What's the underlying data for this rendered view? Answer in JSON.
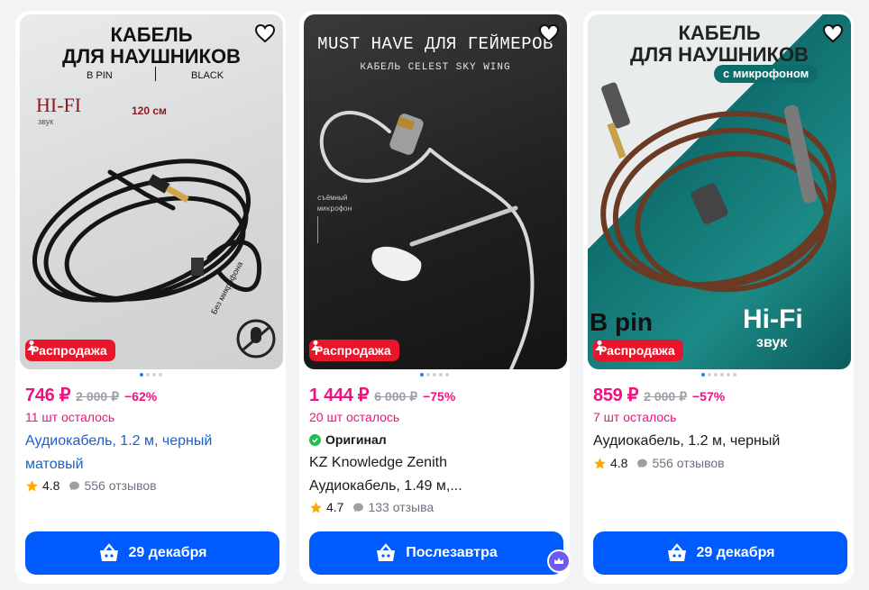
{
  "cards": [
    {
      "photo": {
        "title_line1": "КАБЕЛЬ",
        "title_line2": "ДЛЯ НАУШНИКОВ",
        "sub_left": "B PIN",
        "sub_right": "BLACK",
        "hifi": "HI-FI",
        "sound": "звук",
        "length": "120 см",
        "badge_ring": "Без микрофона"
      },
      "sale_label": "Распродажа",
      "price": "746 ₽",
      "old_price": "2 000 ₽",
      "discount": "−62%",
      "stock": "11 шт осталось",
      "title_lines": [
        "Аудиокабель, 1.2 м, черный",
        "матовый"
      ],
      "rating": "4.8",
      "reviews": "556 отзывов",
      "button": "29 декабря"
    },
    {
      "photo": {
        "title_line1": "MUST HAVE ДЛЯ ГЕЙМЕРОВ",
        "sub": "КАБЕЛЬ CELEST SKY WING",
        "note_line1": "съёмный",
        "note_line2": "микрофон"
      },
      "sale_label": "Распродажа",
      "price": "1 444 ₽",
      "old_price": "6 000 ₽",
      "discount": "−75%",
      "stock": "20 шт осталось",
      "original_label": "Оригинал",
      "brand_line": "KZ Knowledge Zenith",
      "title_line": "Аудиокабель, 1.49 м,...",
      "rating": "4.7",
      "reviews": "133 отзыва",
      "button": "Послезавтра"
    },
    {
      "photo": {
        "title_line1": "КАБЕЛЬ",
        "title_line2": "ДЛЯ НАУШНИКОВ",
        "pill": "с микрофоном",
        "hifi": "Hi-Fi",
        "sound": "звук",
        "bpin": "B pin"
      },
      "sale_label": "Распродажа",
      "price": "859 ₽",
      "old_price": "2 000 ₽",
      "discount": "−57%",
      "stock": "7 шт осталось",
      "title_line": "Аудиокабель, 1.2 м, черный",
      "rating": "4.8",
      "reviews": "556 отзывов",
      "button": "29 декабря"
    }
  ],
  "colors": {
    "accent_blue": "#005bff",
    "price_pink": "#f1117e",
    "sale_red": "#e8152b",
    "link_blue": "#1a5fd1",
    "star": "#ffa800"
  }
}
